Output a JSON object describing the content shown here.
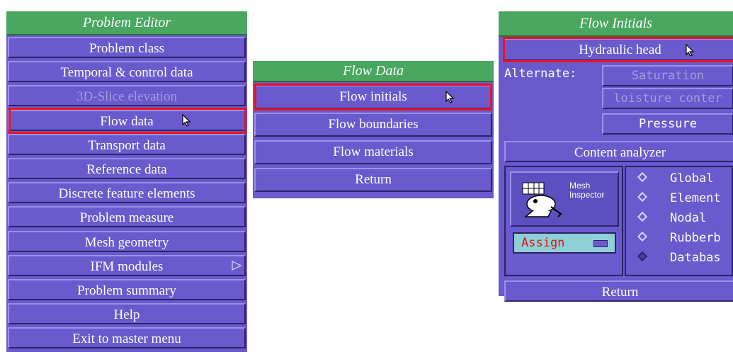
{
  "problem_editor": {
    "title": "Problem Editor",
    "items": [
      {
        "label": "Problem class",
        "enabled": true
      },
      {
        "label": "Temporal & control data",
        "enabled": true
      },
      {
        "label": "3D-Slice elevation",
        "enabled": false
      },
      {
        "label": "Flow data",
        "enabled": true
      },
      {
        "label": "Transport data",
        "enabled": true
      },
      {
        "label": "Reference data",
        "enabled": true
      },
      {
        "label": "Discrete feature elements",
        "enabled": true
      },
      {
        "label": "Problem measure",
        "enabled": true
      },
      {
        "label": "Mesh geometry",
        "enabled": true
      },
      {
        "label": "IFM modules",
        "enabled": true
      },
      {
        "label": "Problem summary",
        "enabled": true
      },
      {
        "label": "Help",
        "enabled": true
      },
      {
        "label": "Exit to master menu",
        "enabled": true
      }
    ]
  },
  "flow_data": {
    "title": "Flow Data",
    "items": [
      {
        "label": "Flow initials"
      },
      {
        "label": "Flow boundaries"
      },
      {
        "label": "Flow materials"
      },
      {
        "label": "Return"
      }
    ]
  },
  "flow_initials": {
    "title": "Flow Initials",
    "hydraulic_head": "Hydraulic head",
    "alternate_label": "Alternate:",
    "saturation": "Saturation",
    "moisture_content": "loisture conter",
    "pressure": "Pressure",
    "content_analyzer": "Content analyzer",
    "mesh_inspector_line1": "Mesh",
    "mesh_inspector_line2": "Inspector",
    "assign": "Assign",
    "radio_options": [
      "Global",
      "Element",
      "Nodal",
      "Rubberb",
      "Databas"
    ],
    "return": "Return"
  },
  "colors": {
    "panel": "#6a5acd",
    "title_bar": "#4aa75f",
    "highlight": "#e8141e",
    "assign_bg": "#8fd0d6",
    "assign_text": "#d9141e"
  }
}
